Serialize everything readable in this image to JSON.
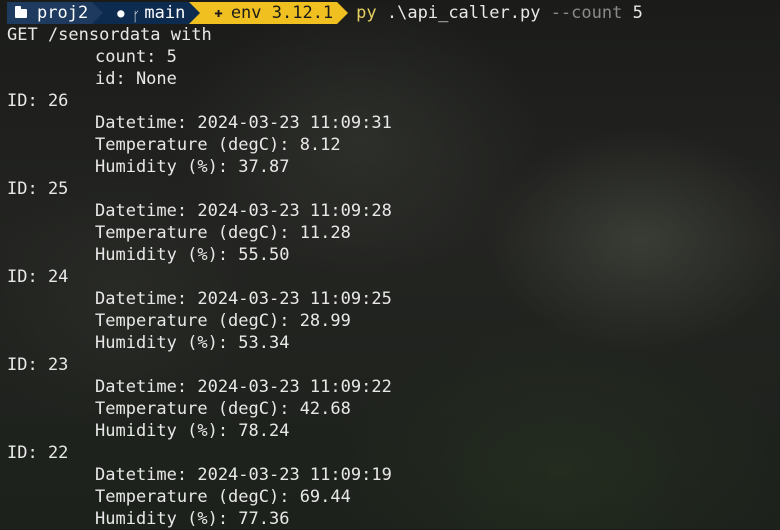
{
  "prompt": {
    "dir": "proj2",
    "branch": "main",
    "env": "env 3.12.1",
    "command": {
      "program": "py",
      "script": ".\\api_caller.py",
      "flag": "--count",
      "value": "5"
    }
  },
  "request": {
    "header": "GET /sensordata with",
    "count_line": "count: 5",
    "id_line": "id: None"
  },
  "records": [
    {
      "id": "ID: 26",
      "datetime": "Datetime: 2024-03-23 11:09:31",
      "temperature": "Temperature (degC): 8.12",
      "humidity": "Humidity (%): 37.87"
    },
    {
      "id": "ID: 25",
      "datetime": "Datetime: 2024-03-23 11:09:28",
      "temperature": "Temperature (degC): 11.28",
      "humidity": "Humidity (%): 55.50"
    },
    {
      "id": "ID: 24",
      "datetime": "Datetime: 2024-03-23 11:09:25",
      "temperature": "Temperature (degC): 28.99",
      "humidity": "Humidity (%): 53.34"
    },
    {
      "id": "ID: 23",
      "datetime": "Datetime: 2024-03-23 11:09:22",
      "temperature": "Temperature (degC): 42.68",
      "humidity": "Humidity (%): 78.24"
    },
    {
      "id": "ID: 22",
      "datetime": "Datetime: 2024-03-23 11:09:19",
      "temperature": "Temperature (degC): 69.44",
      "humidity": "Humidity (%): 77.36"
    }
  ],
  "colors": {
    "dir_segment": "#1e3a5f",
    "git_segment": "#0d2a4f",
    "env_segment": "#f0c020",
    "command": "#e8d060",
    "flag": "#8a8a8a",
    "text": "#e8e8e8"
  },
  "icons": {
    "dir": "folder-icon",
    "git": "github-icon",
    "branch": "git-branch-icon",
    "env": "python-icon"
  }
}
